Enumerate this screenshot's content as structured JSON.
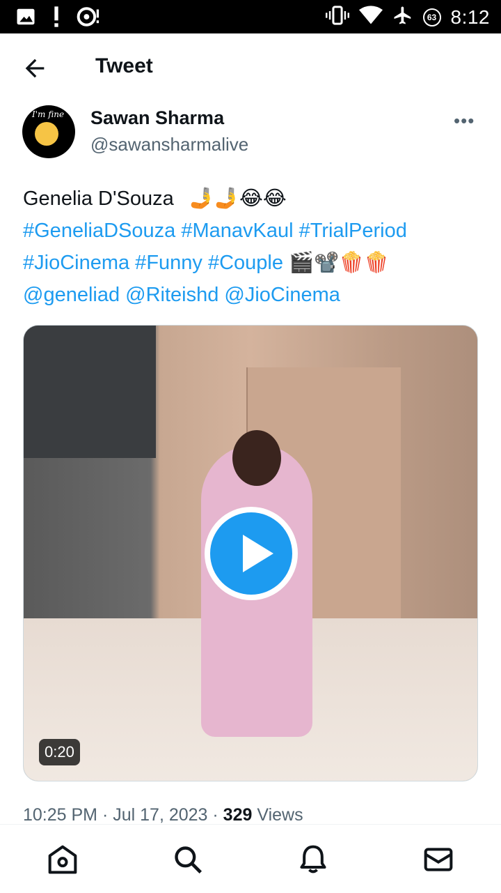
{
  "status_bar": {
    "time": "8:12",
    "battery_level": "63",
    "icons": [
      "image-icon",
      "alert-icon",
      "hotspot-icon",
      "vibrate-icon",
      "wifi-icon",
      "airplane-icon",
      "battery-icon"
    ]
  },
  "header": {
    "title": "Tweet",
    "back_icon": "arrow-left-icon"
  },
  "author": {
    "name": "Sawan Sharma",
    "handle": "@sawansharmalive",
    "avatar_text": "I'm fine",
    "more_label": "•••"
  },
  "tweet": {
    "line1_text": "Genelia D'Souza",
    "line1_emojis": "🤳🤳😂😂",
    "line2": "#GeneliaDSouza #ManavKaul #TrialPeriod",
    "line3_tags": "#JioCinema #Funny #Couple",
    "line3_emojis": "🎬📽️🍿🍿",
    "line4": "@geneliad @Riteishd @JioCinema"
  },
  "media": {
    "duration": "0:20",
    "play_icon": "play-icon"
  },
  "meta": {
    "time": "10:25 PM",
    "date": "Jul 17, 2023",
    "views_count": "329",
    "views_label": "Views"
  },
  "bottom_nav": [
    "home-icon",
    "search-icon",
    "bell-icon",
    "mail-icon"
  ],
  "colors": {
    "accent": "#1d9bf0",
    "muted": "#536471"
  }
}
